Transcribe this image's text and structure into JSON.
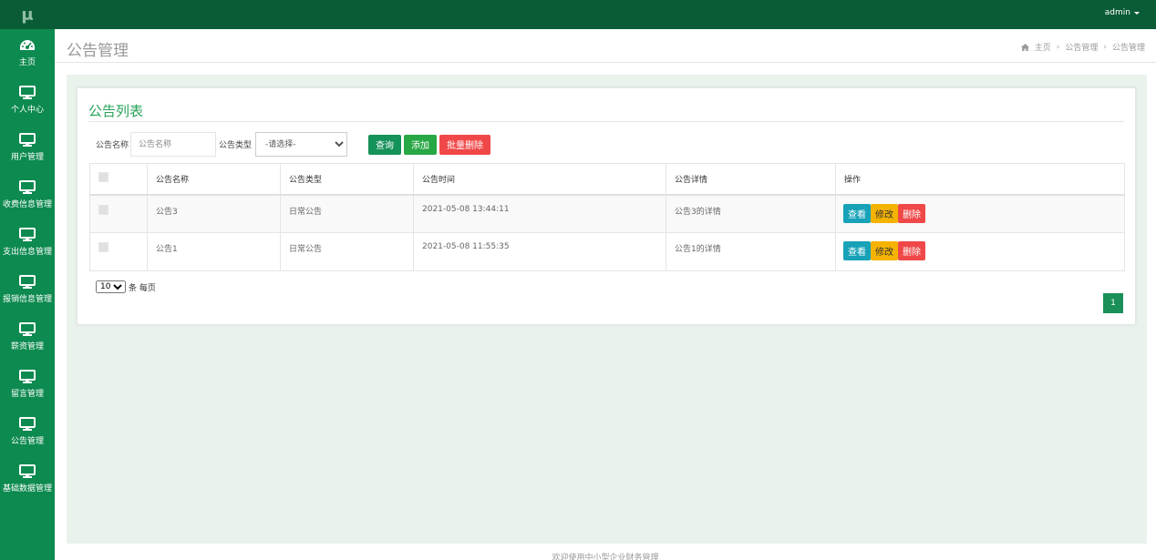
{
  "logo": "μ",
  "sidebar": {
    "items": [
      {
        "label": "主页",
        "icon": "dashboard-icon"
      },
      {
        "label": "个人中心",
        "icon": "monitor-icon"
      },
      {
        "label": "用户管理",
        "icon": "monitor-icon"
      },
      {
        "label": "收费信息管理",
        "icon": "monitor-icon"
      },
      {
        "label": "支出信息管理",
        "icon": "monitor-icon"
      },
      {
        "label": "报销信息管理",
        "icon": "monitor-icon"
      },
      {
        "label": "薪资管理",
        "icon": "monitor-icon"
      },
      {
        "label": "留言管理",
        "icon": "monitor-icon"
      },
      {
        "label": "公告管理",
        "icon": "monitor-icon"
      },
      {
        "label": "基础数据管理",
        "icon": "monitor-icon"
      }
    ]
  },
  "topbar": {
    "user": "admin"
  },
  "header": {
    "title": "公告管理",
    "breadcrumb": [
      "主页",
      "公告管理",
      "公告管理"
    ]
  },
  "panel": {
    "title": "公告列表",
    "search": {
      "name_label": "公告名称",
      "name_placeholder": "公告名称",
      "type_label": "公告类型",
      "type_selected": "-请选择-",
      "query_label": "查询",
      "add_label": "添加",
      "batch_delete_label": "批量删除"
    },
    "table": {
      "columns": [
        "公告名称",
        "公告类型",
        "公告时间",
        "公告详情",
        "操作"
      ],
      "rows": [
        {
          "name": "公告3",
          "type": "日常公告",
          "time": "2021-05-08 13:44:11",
          "detail": "公告3的详情"
        },
        {
          "name": "公告1",
          "type": "日常公告",
          "time": "2021-05-08 11:55:35",
          "detail": "公告1的详情"
        }
      ],
      "actions": {
        "view": "查看",
        "edit": "修改",
        "delete": "删除"
      }
    },
    "pagesize": {
      "value": "10",
      "suffix": "条 每页"
    },
    "page": "1"
  },
  "footer": {
    "text": "欢迎使用中小型企业财务管理"
  },
  "colors": {
    "sidebar": "#0d8a4f",
    "topbar": "#0a5c36",
    "accent": "#27a35a"
  }
}
